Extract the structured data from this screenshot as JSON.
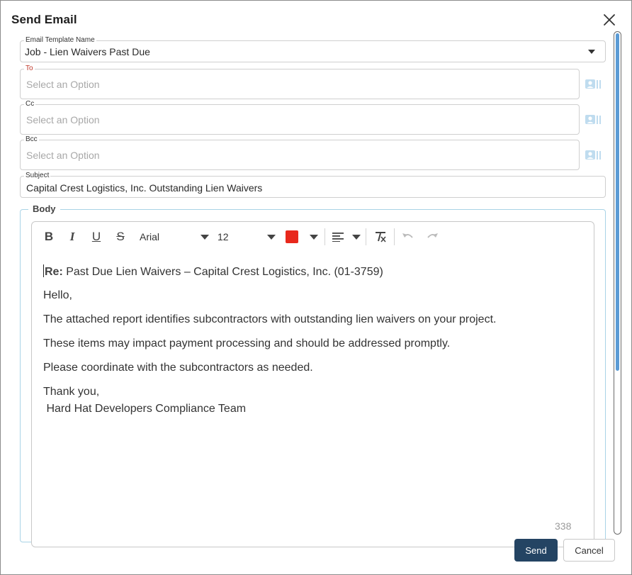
{
  "dialog": {
    "title": "Send Email"
  },
  "template": {
    "label": "Email Template Name",
    "value": "Job - Lien Waivers Past Due"
  },
  "to": {
    "label": "To",
    "placeholder": "Select an Option"
  },
  "cc": {
    "label": "Cc",
    "placeholder": "Select an Option"
  },
  "bcc": {
    "label": "Bcc",
    "placeholder": "Select an Option"
  },
  "subject": {
    "label": "Subject",
    "value": "Capital Crest Logistics, Inc. Outstanding Lien Waivers"
  },
  "body": {
    "legend": "Body",
    "toolbar": {
      "font_family": "Arial",
      "font_size": "12",
      "text_color": "#e8281c",
      "icons": [
        "bold-icon",
        "italic-icon",
        "underline-icon",
        "strikethrough-icon",
        "align-left-icon",
        "clear-format-icon",
        "undo-icon",
        "redo-icon"
      ]
    },
    "content": {
      "re_label": "Re:",
      "re_text": " Past Due Lien Waivers – Capital Crest Logistics, Inc. (01-3759)",
      "greeting": "Hello,",
      "line1": "The attached report identifies subcontractors with outstanding lien waivers on your project.",
      "line2": "These items may impact payment processing and should be addressed promptly.",
      "line3": "Please coordinate with the subcontractors as needed.",
      "signoff": "Thank you,",
      "signature": " Hard Hat Developers Compliance Team"
    },
    "char_count": "338"
  },
  "actions": {
    "send_label": "Send",
    "cancel_label": "Cancel"
  },
  "colors": {
    "primary": "#244463",
    "accent_blue": "#5b9bd5",
    "required_red": "#c0392b",
    "body_border": "#a9d3e6"
  }
}
